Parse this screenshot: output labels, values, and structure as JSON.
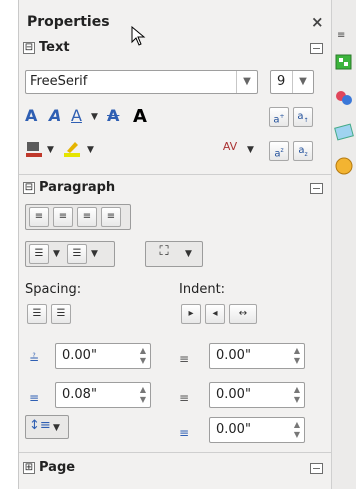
{
  "panel": {
    "title": "Properties",
    "close": "×"
  },
  "sections": {
    "text": {
      "title": "Text",
      "expander": "⊟"
    },
    "paragraph": {
      "title": "Paragraph",
      "expander": "⊟"
    },
    "page": {
      "title": "Page",
      "expander": "⊞"
    }
  },
  "text": {
    "font_name": "FreeSerif",
    "font_size": "9"
  },
  "paragraph": {
    "spacing_label": "Spacing:",
    "indent_label": "Indent:",
    "above_spacing": "0.00\"",
    "below_spacing": "0.08\"",
    "before_indent": "0.00\"",
    "after_indent": "0.00\"",
    "first_line_indent": "0.00\""
  },
  "colors": {
    "accent_blue": "#2f5fb3",
    "panel_bg": "#f2f1f0"
  }
}
